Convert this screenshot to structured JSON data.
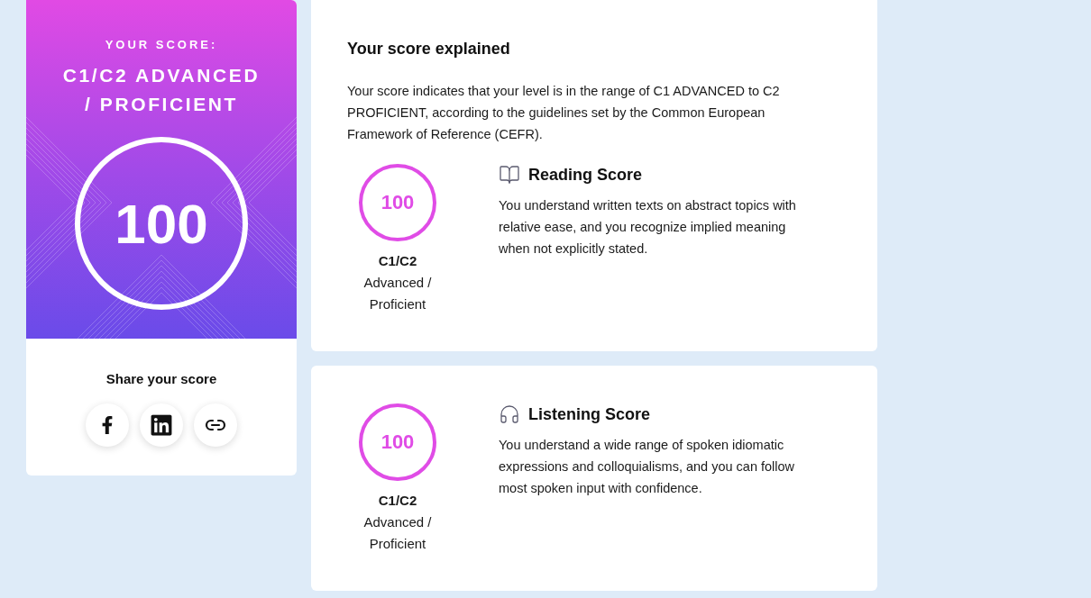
{
  "score_card": {
    "eyebrow": "YOUR SCORE:",
    "level": "C1/C2 ADVANCED / PROFICIENT",
    "score": "100"
  },
  "share": {
    "title": "Share your score",
    "buttons": [
      {
        "kind": "facebook"
      },
      {
        "kind": "linkedin"
      },
      {
        "kind": "link"
      }
    ]
  },
  "explanation": {
    "title": "Your score explained",
    "text": "Your score indicates that your level is in the range of C1 ADVANCED to C2 PROFICIENT, according to the guidelines set by the Common European Framework of Reference (CEFR)."
  },
  "skills": [
    {
      "kind": "reading",
      "score": "100",
      "level": "C1/C2",
      "level_name": "Advanced / Proficient",
      "title": "Reading Score",
      "description": "You understand written texts on abstract topics with relative ease, and you recognize implied meaning when not explicitly stated."
    },
    {
      "kind": "listening",
      "score": "100",
      "level": "C1/C2",
      "level_name": "Advanced / Proficient",
      "title": "Listening Score",
      "description": "You understand a wide range of spoken idiomatic expressions and colloquialisms, and you can follow most spoken input with confidence."
    }
  ]
}
